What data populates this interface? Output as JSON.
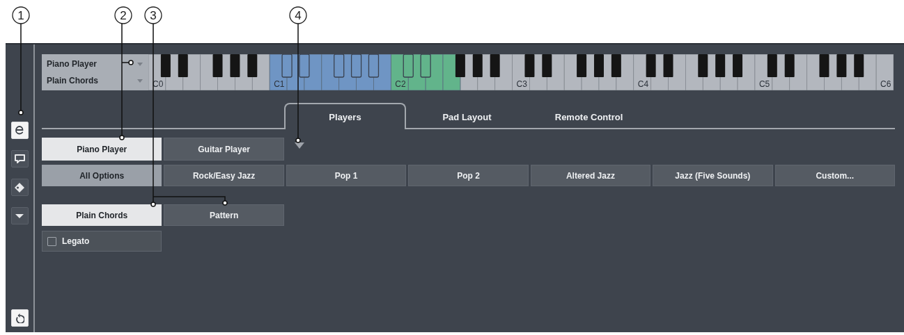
{
  "callouts": [
    "1",
    "2",
    "3",
    "4"
  ],
  "sidebar": {
    "items": [
      {
        "kind": "editor",
        "selected": true
      },
      {
        "kind": "comment",
        "selected": false
      },
      {
        "kind": "tag",
        "selected": false
      },
      {
        "kind": "collapse",
        "selected": false
      }
    ],
    "footer": {
      "kind": "reset",
      "selected": true
    }
  },
  "preset": {
    "player": "Piano Player",
    "style": "Plain Chords"
  },
  "keyboard": {
    "octave_labels": [
      "C0",
      "C1",
      "C2",
      "C3",
      "C4",
      "C5",
      "C6"
    ],
    "highlights": [
      {
        "color": "#6f95c4"
      },
      {
        "color": "#62b48b"
      }
    ]
  },
  "tabs": [
    {
      "label": "Players",
      "selected": true
    },
    {
      "label": "Pad Layout",
      "selected": false
    },
    {
      "label": "Remote Control",
      "selected": false
    }
  ],
  "players": [
    {
      "label": "Piano Player",
      "selected": true
    },
    {
      "label": "Guitar Player",
      "selected": false
    }
  ],
  "styles": [
    {
      "label": "All Options",
      "selected": true
    },
    {
      "label": "Rock/Easy Jazz",
      "selected": false
    },
    {
      "label": "Pop 1",
      "selected": false
    },
    {
      "label": "Pop 2",
      "selected": false
    },
    {
      "label": "Altered Jazz",
      "selected": false
    },
    {
      "label": "Jazz (Five Sounds)",
      "selected": false
    },
    {
      "label": "Custom...",
      "selected": false
    }
  ],
  "modes": [
    {
      "label": "Plain Chords",
      "selected": true
    },
    {
      "label": "Pattern",
      "selected": false
    }
  ],
  "legato": {
    "label": "Legato",
    "checked": false
  }
}
